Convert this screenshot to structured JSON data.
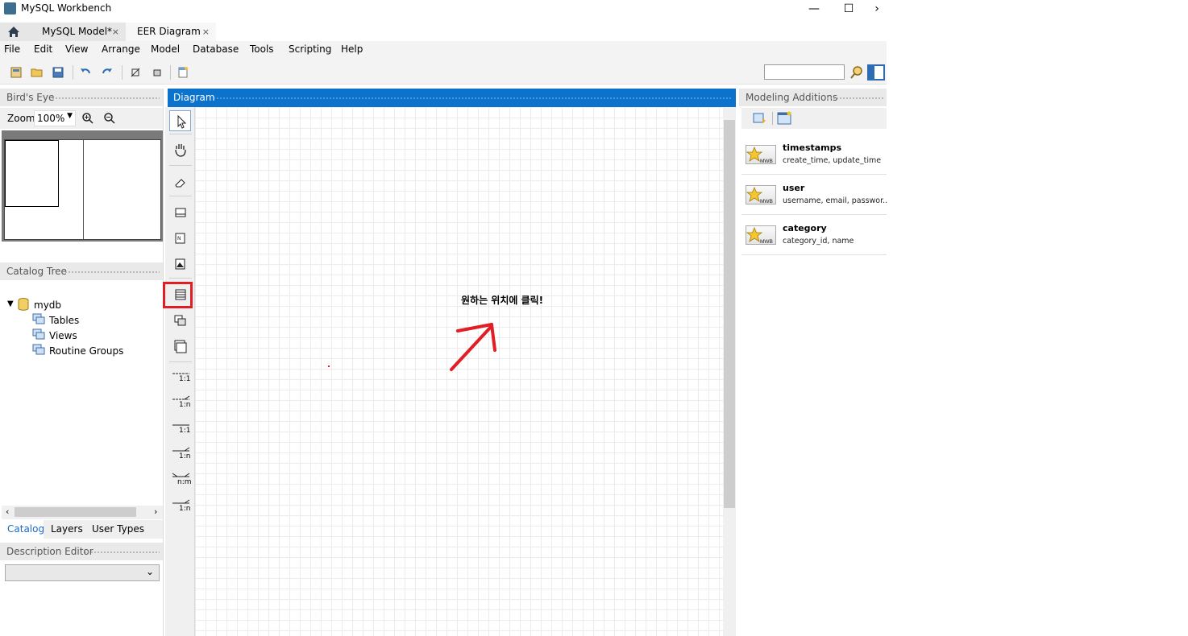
{
  "window": {
    "title": "MySQL Workbench",
    "minimize": "—",
    "maximize": "☐",
    "close": "›"
  },
  "tabs": [
    {
      "label": "MySQL Model*",
      "close": "×"
    },
    {
      "label": "EER Diagram",
      "close": "×"
    }
  ],
  "menu": [
    "File",
    "Edit",
    "View",
    "Arrange",
    "Model",
    "Database",
    "Tools",
    "Scripting",
    "Help"
  ],
  "birds_eye": {
    "title": "Bird's Eye",
    "zoom_label": "Zoom:",
    "zoom_value": "100%"
  },
  "catalog_tree": {
    "title": "Catalog Tree",
    "schema": "mydb",
    "children": [
      "Tables",
      "Views",
      "Routine Groups"
    ]
  },
  "bottom_tabs": [
    "Catalog",
    "Layers",
    "User Types"
  ],
  "description_editor": {
    "title": "Description Editor"
  },
  "diagram": {
    "title": "Diagram"
  },
  "palette_labels": {
    "r1": "1:1",
    "r2": "1:n",
    "r3": "1:1",
    "r4": "1:n",
    "r5": "n:m",
    "r6": "1:n"
  },
  "annotation": {
    "text": "원하는 위치에 클릭!",
    "color": "#e11d25"
  },
  "modeling_additions": {
    "title": "Modeling Additions",
    "snippets": [
      {
        "name": "timestamps",
        "cols": "create_time, update_time",
        "badge": "MWB"
      },
      {
        "name": "user",
        "cols": "username, email, passwor...",
        "badge": "MWB"
      },
      {
        "name": "category",
        "cols": "category_id, name",
        "badge": "MWB"
      }
    ]
  },
  "colors": {
    "accent": "#0b73cb",
    "highlight": "#e11d25"
  }
}
